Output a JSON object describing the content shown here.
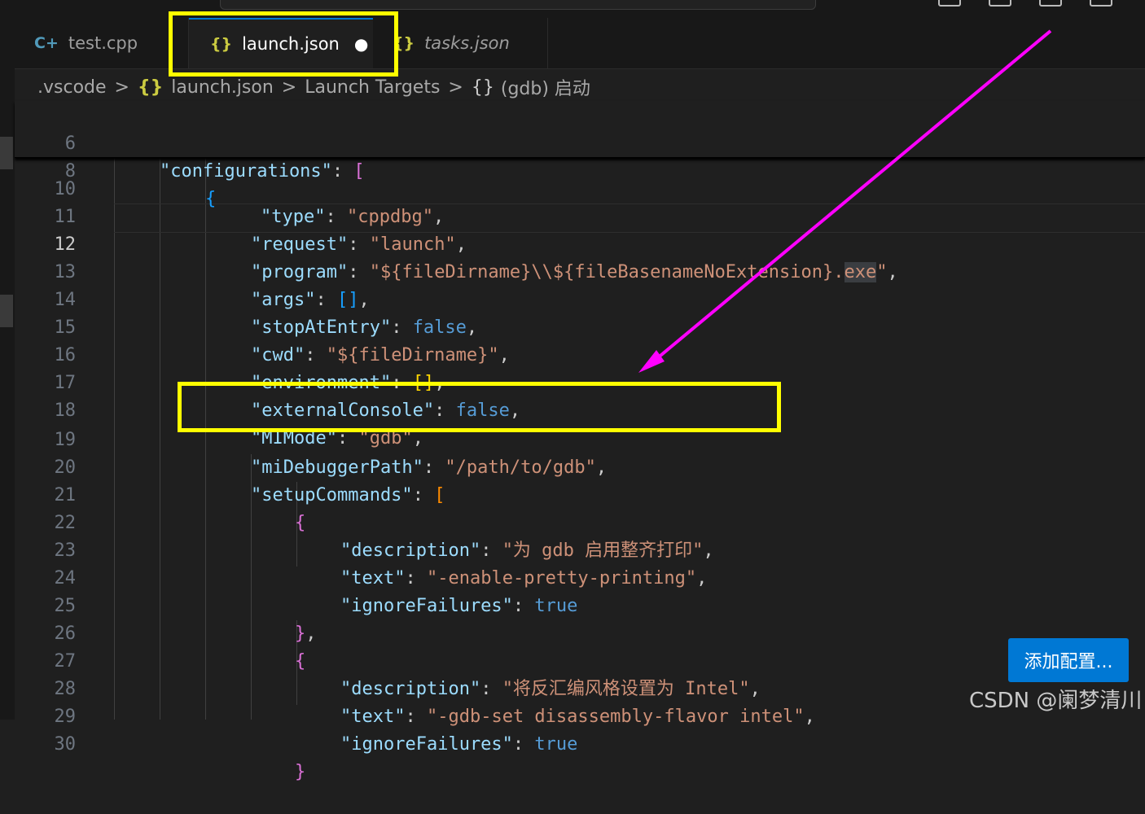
{
  "tabs": [
    {
      "label": "test.cpp",
      "icon": "cpp-icon"
    },
    {
      "label": "launch.json",
      "icon": "json-icon",
      "dirty": "●"
    },
    {
      "label": "tasks.json",
      "icon": "json-icon"
    }
  ],
  "breadcrumb": {
    "folder": ".vscode",
    "file": "launch.json",
    "section": "Launch Targets",
    "item": "(gdb) 启动",
    "sep": ">",
    "json_glyph": "{}",
    "obj_glyph": "{}"
  },
  "sticky": {
    "l6": {
      "num": "6",
      "key": "\"configurations\"",
      "colon": ": ",
      "open": "["
    },
    "l8": {
      "num": "8",
      "open": "{"
    }
  },
  "partial_line": {
    "num": "10",
    "key": "\"type\"",
    "colon": ": ",
    "value": "\"cppdbg\"",
    "comma": ","
  },
  "code": {
    "l11": {
      "num": "11",
      "key": "\"request\"",
      "colon": ": ",
      "value": "\"launch\"",
      "comma": ","
    },
    "l12": {
      "num": "12",
      "key": "\"program\"",
      "colon": ": ",
      "value_a": "\"${fileDirname}\\\\${fileBasenameNoExtension}.",
      "value_hl": "exe",
      "value_b": "\"",
      "comma": ","
    },
    "l13": {
      "num": "13",
      "key": "\"args\"",
      "colon": ": ",
      "value": "[]",
      "comma": ","
    },
    "l14": {
      "num": "14",
      "key": "\"stopAtEntry\"",
      "colon": ": ",
      "value": "false",
      "comma": ","
    },
    "l15": {
      "num": "15",
      "key": "\"cwd\"",
      "colon": ": ",
      "value": "\"${fileDirname}\"",
      "comma": ","
    },
    "l16": {
      "num": "16",
      "key": "\"environment\"",
      "colon": ": ",
      "value": "[]",
      "comma": ","
    },
    "l17": {
      "num": "17",
      "key": "\"externalConsole\"",
      "colon": ": ",
      "value": "false",
      "comma": ","
    },
    "l18": {
      "num": "18",
      "key": "\"MIMode\"",
      "colon": ": ",
      "value": "\"gdb\"",
      "comma": ","
    },
    "l19": {
      "num": "19",
      "key": "\"miDebuggerPath\"",
      "colon": ": ",
      "value": "\"/path/to/gdb\"",
      "comma": ","
    },
    "l20": {
      "num": "20",
      "key": "\"setupCommands\"",
      "colon": ": ",
      "value": "["
    },
    "l21": {
      "num": "21",
      "value": "{"
    },
    "l22": {
      "num": "22",
      "key": "\"description\"",
      "colon": ": ",
      "value": "\"为 gdb 启用整齐打印\"",
      "comma": ","
    },
    "l23": {
      "num": "23",
      "key": "\"text\"",
      "colon": ": ",
      "value": "\"-enable-pretty-printing\"",
      "comma": ","
    },
    "l24": {
      "num": "24",
      "key": "\"ignoreFailures\"",
      "colon": ": ",
      "value": "true"
    },
    "l25": {
      "num": "25",
      "value": "}",
      "comma": ","
    },
    "l26": {
      "num": "26",
      "value": "{"
    },
    "l27": {
      "num": "27",
      "key": "\"description\"",
      "colon": ": ",
      "value": "\"将反汇编风格设置为 Intel\"",
      "comma": ","
    },
    "l28": {
      "num": "28",
      "key": "\"text\"",
      "colon": ": ",
      "value": "\"-gdb-set disassembly-flavor intel\"",
      "comma": ","
    },
    "l29": {
      "num": "29",
      "key": "\"ignoreFailures\"",
      "colon": ": ",
      "value": "true"
    },
    "l30": {
      "num": "30",
      "value": "}"
    }
  },
  "add_config_button": "添加配置...",
  "watermark": "CSDN @阑梦清川",
  "colors": {
    "annotation_box": "#ffff00",
    "annotation_arrow": "#ff00ff",
    "button": "#0078d4"
  }
}
